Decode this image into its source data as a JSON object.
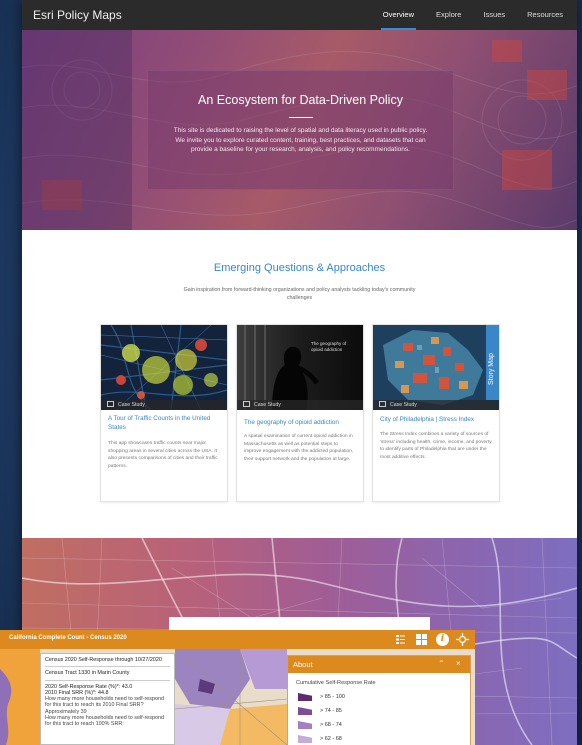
{
  "nav": {
    "brand": "Esri Policy Maps",
    "links": [
      "Overview",
      "Explore",
      "Issues",
      "Resources"
    ]
  },
  "hero": {
    "title": "An Ecosystem for Data-Driven Policy",
    "text": "This site is dedicated to raising the level of spatial and data literacy used in public policy. We invite you to explore curated content, training, best practices, and datasets that can provide a baseline for your research, analysis, and policy recommendations."
  },
  "section": {
    "title": "Emerging Questions & Approaches",
    "subtitle": "Gain inspiration from forward-thinking organizations and policy analysts tackling today's community challenges"
  },
  "cards": [
    {
      "badge": "Case Study",
      "title": "A Tour of Traffic Counts in the United States",
      "desc": "This app showcases traffic counts near major shopping areas in several cities across the USA. It also presents comparisons of cities and their traffic patterns."
    },
    {
      "badge": "Case Study",
      "title": "The geography of opioid addiction",
      "desc": "A spatial examination of current opioid addiction in Massachusetts as well as potential steps to improve engagement with the addicted population, their support network and the population at large.",
      "image_text": "The geography of opioid addiction"
    },
    {
      "badge": "Case Study",
      "title": "City of Philadelphia | Stress Index",
      "desc": "The Stress Index combines a variety of sources of 'stress' including health, crime, income, and poverty to identify parts of Philadelphia that are under the most additive effects.",
      "ribbon": "Story Map"
    }
  ],
  "embed": {
    "title": "California Complete Count - Census 2020",
    "popup": {
      "heading": "Census 2020 Self-Response through 10/27/2020",
      "tract": "Census Tract 1330 in Marin County",
      "line1": "2020 Self-Response Rate (%)*: 43.0",
      "line2": "2010 Final SRR (%)*: 44.8",
      "line3": "How many more households need to self-respond for this tract to reach its 2010 Final SRR? Approximately 39",
      "line4": "How many more households need to self-respond for this tract to reach 100% SRR:"
    },
    "about": {
      "title": "About",
      "subtitle": "Cumulative Self-Response Rate",
      "legend": [
        {
          "label": "> 85 - 100",
          "color": "#5b2c6e"
        },
        {
          "label": "> 74 - 85",
          "color": "#7e4d98"
        },
        {
          "label": "> 68 - 74",
          "color": "#a77fc0"
        },
        {
          "label": "> 62 - 68",
          "color": "#c6aad8"
        }
      ]
    }
  }
}
